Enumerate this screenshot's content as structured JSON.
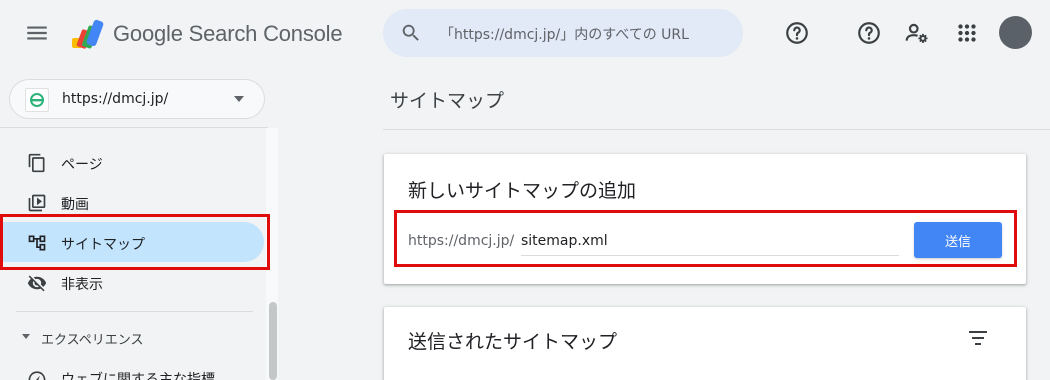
{
  "header": {
    "app_name": "Google Search Console",
    "search_placeholder": "「https://dmcj.jp/」内のすべての URL",
    "icons": [
      "menu-icon",
      "search-icon",
      "help-icon",
      "help-icon",
      "manage-users-icon",
      "apps-grid-icon",
      "account-avatar"
    ]
  },
  "property": {
    "url": "https://dmcj.jp/"
  },
  "sidebar": {
    "items": [
      {
        "label": "ページ",
        "icon": "pages-icon"
      },
      {
        "label": "動画",
        "icon": "video-icon"
      },
      {
        "label": "サイトマップ",
        "icon": "sitemap-icon",
        "active": true
      },
      {
        "label": "非表示",
        "icon": "hidden-eye-icon"
      }
    ],
    "section_label": "エクスペリエンス",
    "partial_item": "ウェブに関する主な指標"
  },
  "main": {
    "page_title": "サイトマップ",
    "add_card": {
      "title": "新しいサイトマップの追加",
      "url_prefix": "https://dmcj.jp/",
      "input_value": "sitemap.xml",
      "submit_label": "送信"
    },
    "submitted_card": {
      "title": "送信されたサイトマップ"
    }
  },
  "colors": {
    "accent": "#4285f4",
    "active_nav": "#c2e4fd",
    "annotation": "#e00b0b",
    "background": "#f1f3f4"
  }
}
